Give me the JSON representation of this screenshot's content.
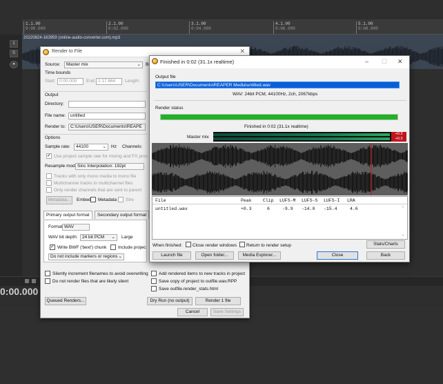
{
  "daw": {
    "item_label": "20220824-163959 (online-audio-converter.com).mp3",
    "ruler": [
      {
        "bar": "1.1.00",
        "time": "0:00.000"
      },
      {
        "bar": "2.1.00",
        "time": "0:02.000"
      },
      {
        "bar": "3.1.00",
        "time": "0:04.000"
      },
      {
        "bar": "4.1.00",
        "time": "0:06.000"
      },
      {
        "bar": "5.1.00",
        "time": "0:08.000"
      }
    ],
    "time_display": "0:00.000",
    "track_numbers": [
      "1"
    ]
  },
  "render": {
    "title": "Render to File",
    "source_label": "Source:",
    "source_value": "Master mix",
    "bounds_cut": "Bo",
    "time_bounds": "Time bounds",
    "start_label": "Start:",
    "start_value": "0:00.000",
    "end_label": "End:",
    "end_value": "1:17.864",
    "length_label": "Length:",
    "output_label": "Output",
    "directory_label": "Directory:",
    "directory_value": "",
    "filename_label": "File name:",
    "filename_value": "untitled",
    "renderto_label": "Render to:",
    "renderto_value": "C:\\Users\\USER\\Documents\\REAPE",
    "options_label": "Options",
    "samplerate_label": "Sample rate:",
    "samplerate_value": "44100",
    "hz": "Hz",
    "channels_label": "Channels:",
    "use_project_rate": "Use project sample rate for mixing and FX proc",
    "resample_label": "Resample mode:",
    "resample_value": "Sinc Interpolation: 192pt",
    "tracks_mono": "Tracks with only mono media to mono file",
    "multichannel": "Multichannel tracks to multichannel files",
    "only_render": "Only render channels that are sent to parent",
    "metadata_btn": "Metadata...",
    "embed_label": "Embed:",
    "metadata_chk": "Metadata",
    "stre": "Stre",
    "primary_tab": "Primary output format",
    "secondary_tab": "Secondary output format",
    "format_label": "Format:",
    "format_value": "WAV",
    "wav_depth_label": "WAV bit depth:",
    "wav_depth_value": "24 bit PCM",
    "large_label": "Large",
    "write_bwf": "Write BWF ('bext') chunk",
    "include_project": "Include projec",
    "markers_value": "Do not include markers or regions",
    "silently_increment": "Silently increment filenames to avoid overwriting",
    "do_not_render": "Do not render files that are likely silent",
    "add_rendered": "Add rendered items to new tracks in project",
    "save_copy": "Save copy of project to outfile.wav.RPP",
    "save_stats": "Save outfile.render_stats.html",
    "queued_btn": "Queued Renders...",
    "dryrun_btn": "Dry Run (no output)",
    "render1_btn": "Render 1 file",
    "cancel_btn": "Cancel",
    "save_settings_btn": "Save Settings"
  },
  "finished": {
    "title": "Finished in 0:02  (31.1x realtime)",
    "output_file_label": "Output file",
    "path": "C:\\Users\\USER\\Documents\\REAPER Media\\untitled.wav",
    "format_info": "WAV: 24bit PCM, 44100Hz, 2ch, 2067kbps",
    "render_status_label": "Render status",
    "progress": 1.0,
    "status_text": "Finished in 0:02  (31.1x realtime)",
    "master_mix_label": "Master mix",
    "meter_peak_top": "+0.3",
    "meter_peak_bottom": "+0.3",
    "stats_headers": [
      "File",
      "Peak",
      "Clip",
      "LUFS-M",
      "LUFS-S",
      "LUFS-I",
      "LRA"
    ],
    "stats_row": [
      "untitled.wav",
      "+0.3",
      "6",
      "-9.9",
      "-14.0",
      "-15.4",
      "4.6"
    ],
    "when_finished_label": "When finished:",
    "close_render_windows": "Close render windows",
    "return_render_setup": "Return to render setup",
    "launch_btn": "Launch file",
    "open_folder_btn": "Open folder...",
    "media_explorer_btn": "Media Explorer...",
    "close_btn": "Close",
    "stats_charts_btn": "Stats/Charts",
    "back_btn": "Back"
  },
  "colors": {
    "progress_green": "#1fb323",
    "selection_blue": "#0a5fd6",
    "waveform": "#0c0c0c",
    "waveform_bg": "#5e5e5e",
    "clip_red": "#c0141c"
  }
}
